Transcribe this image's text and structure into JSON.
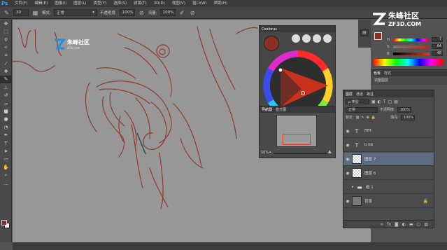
{
  "app": {
    "logo": "Ps"
  },
  "menu": [
    "文件(F)",
    "编辑(E)",
    "图像(I)",
    "图层(L)",
    "类型(Y)",
    "选择(S)",
    "滤镜(T)",
    "3D(D)",
    "视图(V)",
    "窗口(W)",
    "帮助(H)"
  ],
  "options": {
    "brush_size": "30",
    "mode_label": "模式:",
    "mode_value": "正常",
    "opacity_label": "不透明度:",
    "opacity_value": "100%",
    "flow_label": "流量:",
    "flow_value": "100%"
  },
  "watermark": {
    "canvas_text": "朱峰社区",
    "canvas_sub": "zf3d.com",
    "top_text": "朱峰社区",
    "top_sub": "ZF3D.COM"
  },
  "coolorus": {
    "title": "Coolorus",
    "nav_tabs": [
      "导航器",
      "直方图"
    ],
    "zoom": "50%",
    "fg_color": "#8b2f23"
  },
  "color_panel": {
    "labels": [
      "H",
      "S",
      "B"
    ],
    "values": [
      "7",
      "64",
      "48"
    ]
  },
  "mini_tabs": [
    "色板",
    "样式"
  ],
  "mini_text": "调整图层",
  "layers": {
    "tabs": [
      "图层",
      "通道",
      "路径"
    ],
    "filter_label": "ρ 类型",
    "blend_mode": "正常",
    "opacity_label": "不透明度:",
    "opacity_value": "100%",
    "lock_label": "锁定:",
    "fill_label": "填充:",
    "fill_value": "100%",
    "rows": [
      {
        "name": "fffff",
        "type": "text",
        "selected": false
      },
      {
        "name": "b bb",
        "type": "text",
        "selected": false
      },
      {
        "name": "图层 7",
        "type": "pixel",
        "selected": true
      },
      {
        "name": "图层 6",
        "type": "pixel",
        "selected": false
      },
      {
        "name": "组 1",
        "type": "group",
        "selected": false
      },
      {
        "name": "背景",
        "type": "background",
        "selected": false
      }
    ],
    "footer_icons": [
      "link-icon",
      "fx-icon",
      "mask-icon",
      "adjustment-icon",
      "folder-icon",
      "new-layer-icon",
      "trash-icon"
    ]
  }
}
